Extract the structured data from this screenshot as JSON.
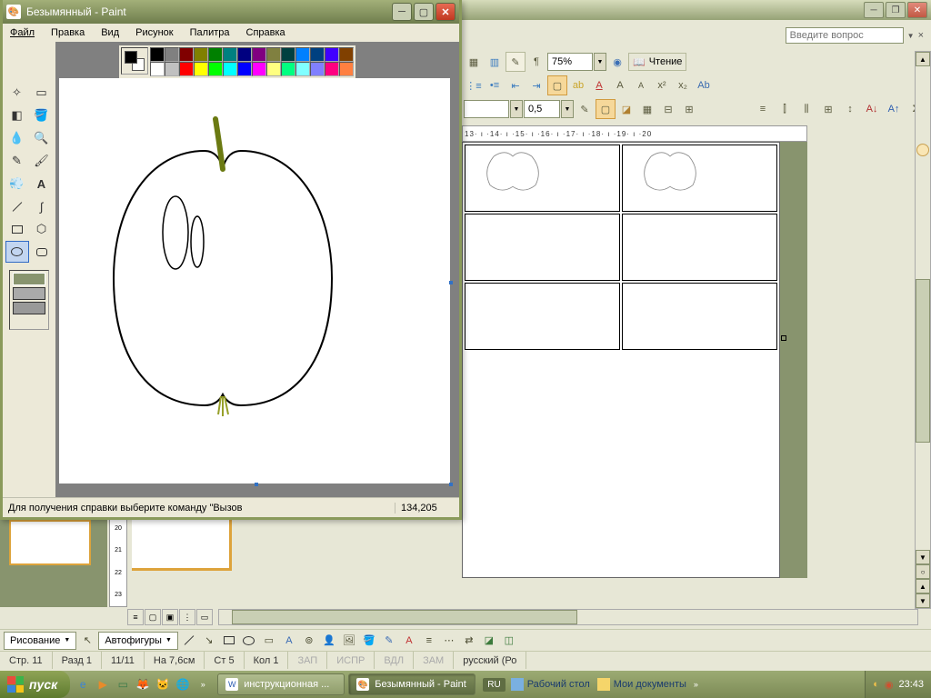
{
  "word": {
    "help_placeholder": "Введите вопрос",
    "zoom": "75%",
    "reading": "Чтение",
    "line_weight": "0,5",
    "ruler_ticks": "13· ı ·14· ı ·15· ı ·16· ı ·17· ı ·18· ı ·19· ı ·20",
    "vruler": [
      "20",
      "21",
      "22",
      "23"
    ]
  },
  "paint": {
    "title": "Безымянный - Paint",
    "menu": [
      "Файл",
      "Правка",
      "Вид",
      "Рисунок",
      "Палитра",
      "Справка"
    ],
    "status_help": "Для получения справки выберите команду \"Вызов",
    "coords": "134,205",
    "palette_row1": [
      "#000000",
      "#808080",
      "#800000",
      "#808000",
      "#008000",
      "#008080",
      "#000080",
      "#800080",
      "#808040",
      "#004040",
      "#0080ff",
      "#004080",
      "#4000ff",
      "#804000"
    ],
    "palette_row2": [
      "#ffffff",
      "#c0c0c0",
      "#ff0000",
      "#ffff00",
      "#00ff00",
      "#00ffff",
      "#0000ff",
      "#ff00ff",
      "#ffff80",
      "#00ff80",
      "#80ffff",
      "#8080ff",
      "#ff0080",
      "#ff8040"
    ]
  },
  "drawing": {
    "menu_label": "Рисование",
    "autoshapes": "Автофигуры"
  },
  "status": {
    "page": "Стр. 11",
    "section": "Разд 1",
    "pages": "11/11",
    "at": "На  7,6см",
    "line": "Ст 5",
    "col": "Кол 1",
    "rec": "ЗАП",
    "trk": "ИСПР",
    "ext": "ВДЛ",
    "ovr": "ЗАМ",
    "lang": "русский (Ро"
  },
  "taskbar": {
    "start": "пуск",
    "tasks": [
      {
        "label": "инструкционная ...",
        "active": false
      },
      {
        "label": "Безымянный - Paint",
        "active": true
      }
    ],
    "lang": "RU",
    "desktop_links": [
      "Рабочий стол",
      "Мои документы"
    ],
    "time": "23:43"
  }
}
